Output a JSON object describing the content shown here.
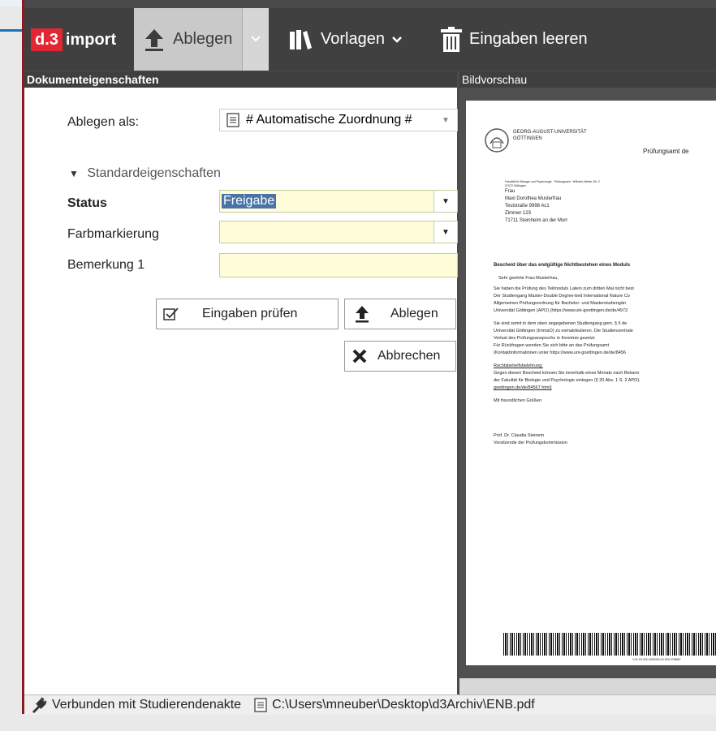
{
  "toolbar": {
    "logo_badge": "d.3",
    "logo_text": "import",
    "ablegen": "Ablegen",
    "vorlagen": "Vorlagen",
    "eingaben_leeren": "Eingaben leeren"
  },
  "left_panel": {
    "header": "Dokumenteigenschaften",
    "ablegen_als_label": "Ablegen als:",
    "ablegen_als_value": "# Automatische Zuordnung #",
    "section_label": "Standardeigenschaften",
    "status_label": "Status",
    "status_value": "Freigabe",
    "farbmarkierung_label": "Farbmarkierung",
    "bemerkung_label": "Bemerkung 1",
    "btn_pruefen": "Eingaben prüfen",
    "btn_ablegen": "Ablegen",
    "btn_abbrechen": "Abbrechen"
  },
  "right_panel": {
    "header": "Bildvorschau",
    "doc": {
      "uni_line1": "GEORG-AUGUST-UNIVERSITÄT",
      "uni_line2": "GÖTTINGEN",
      "office": "Prüfungsamt de",
      "sender": "Fakultät für Biologie und Psychologie · Prüfungsamt · Wilhelm-Weber-Str. 2",
      "sender2": "37073 Göttingen",
      "addr": [
        "Frau",
        "Maxi Dorothea Musterfrau",
        "Teststraße 9998 Ac1",
        "Zimmer 123",
        "71711 Steinheim an der Murr"
      ],
      "subject": "Bescheid über das endgültige Nichtbestehen eines Moduls",
      "salutation": "Sehr geehrte Frau Musterfrau,",
      "para1": [
        "Sie haben die Prüfung des Teilmoduls Latein zum dritten Mal nicht best",
        "Der Studiengang Master-Double Degree-bed International Nature Co",
        "Allgemeinen Prüfungsordnung für Bachelor- und Masterstudiengän",
        "Universität Göttingen (APO) (https://www.uni-goettingen.de/de/4973"
      ],
      "para2": [
        "Sie sind somit in dem oben angegebenen Studiengang gem. § 6 de",
        "Universität Göttingen (ImmaO) zu exmatrikulieren. Die Studienzentrale",
        "Verlust des Prüfungsanspruchs in Kenntnis gesetzt.",
        "Für Rückfragen wenden Sie sich bitte an das Prüfungsamt",
        "(Kontaktinformationen unter https://www.uni-goettingen.de/de/8456"
      ],
      "rb_title": "Rechtsbehelfsbelehrung:",
      "rb": [
        "Gegen diesen Bescheid können Sie innerhalb eines Monats nach Bekann",
        "der Fakultät für Biologie und Psychologie einlegen (§ 20 Abs. 1 S. 2 APO).",
        "goettingen.de/de/84567.html)"
      ],
      "closing": "Mit freundlichen Grüßen",
      "sig1": "Prof. Dr. Claudia Steinem",
      "sig2": "Vorsitzende der Prüfungskommission",
      "barcode_text": "*UG-03-032-2000000-00-929-278589*"
    }
  },
  "statusbar": {
    "connection": "Verbunden mit Studierendenakte",
    "path": "C:\\Users\\mneuber\\Desktop\\d3Archiv\\ENB.pdf"
  }
}
